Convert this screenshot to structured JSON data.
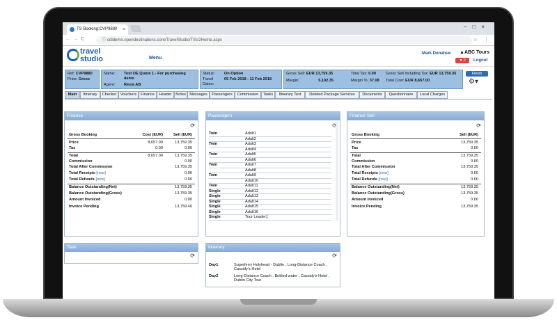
{
  "browser": {
    "tab_title": "TS Booking:CVP9880",
    "url": "odldemo.opendestinations.com/TravelStudio/TSV2Home.aspx"
  },
  "header": {
    "logo_line1": "travel",
    "logo_line2": "studio",
    "menu": "Menu",
    "user": "Mark Donahue",
    "company": "ABC Tours",
    "badge": "▼ 0",
    "logout": "Logout"
  },
  "summary": {
    "ref_label": "Ref:",
    "ref_value": "CVP9880",
    "price_label": "Price:",
    "price_value": "Gross",
    "name_label": "Name:",
    "name_value": "Test OE Quote 1 - For purchasing demo",
    "agent_label": "Agent:",
    "agent_value": "Resia AB",
    "status_label": "Status:",
    "status_value": "On Option",
    "travel_label": "Travel Dates:",
    "travel_value": "05 Feb 2018 - 11 Feb 2018",
    "gross_sell_label": "Gross Sell:",
    "gross_sell_value": "EUR 13,759.35",
    "total_tax_label": "Total Tax:",
    "total_tax_value": "0.00",
    "sell_incl_tax_label": "Gross Sell Including Tax:",
    "sell_incl_tax_value": "EUR 13,759.35",
    "margin_label": "Margin:",
    "margin_value": "5,102.35",
    "margin_pct_label": "Margin %:",
    "margin_pct_value": "37.08",
    "total_cost_label": "Total Cost:",
    "total_cost_value": "EUR 8,657.00",
    "finish": "Finish"
  },
  "tabs": [
    "Main",
    "Itinerary",
    "Checker",
    "Vouchers",
    "Finance",
    "Header",
    "Notes",
    "Messages",
    "Passengers",
    "Commission",
    "Tasks",
    "Itinerary Text",
    "Deleted Package Services",
    "Documents",
    "Questionnaire",
    "Local Charges"
  ],
  "finance": {
    "title": "Finance",
    "col_label": "Gross Booking",
    "col_cost": "Cost  (EUR)",
    "col_sell": "Sell  (EUR)",
    "price": {
      "label": "Price",
      "cost": "8,657.00",
      "sell": "13,759.35"
    },
    "tax": {
      "label": "Tax",
      "cost": "0.00",
      "sell": "0.00"
    },
    "total": {
      "label": "Total",
      "cost": "8,657.00",
      "sell": "13,759.35"
    },
    "commission": {
      "label": "Commission",
      "sell": "0.00"
    },
    "after_commission": {
      "label": "Total After Commission",
      "sell": "13,759.35"
    },
    "receipts": {
      "label": "Total Receipts",
      "link": "[new]",
      "sell": "0.00"
    },
    "refunds": {
      "label": "Total Refunds",
      "link": "[new]",
      "sell": "0.00"
    },
    "bal_net": {
      "label": "Balance Outstanding(Net)",
      "sell": "13,759.35"
    },
    "bal_gross": {
      "label": "Balance Outstanding(Gross)",
      "sell": "13,759.35"
    },
    "invoiced": {
      "label": "Amount Invoiced",
      "sell": "0.00"
    },
    "pending": {
      "label": "Invoice Pending",
      "sell": "13,759.40"
    }
  },
  "passengers": {
    "title": "Passengers",
    "rows": [
      {
        "type": "Twin",
        "name": "Adult1"
      },
      {
        "type": "",
        "name": "Adult2"
      },
      {
        "type": "Twin",
        "name": "Adult3"
      },
      {
        "type": "",
        "name": "Adult4"
      },
      {
        "type": "Twin",
        "name": "Adult5"
      },
      {
        "type": "",
        "name": "Adult6"
      },
      {
        "type": "Twin",
        "name": "Adult7"
      },
      {
        "type": "",
        "name": "Adult8"
      },
      {
        "type": "Twin",
        "name": "Adult9"
      },
      {
        "type": "",
        "name": "Adult10"
      },
      {
        "type": "Twin",
        "name": "Adult11"
      },
      {
        "type": "Single",
        "name": "Adult12"
      },
      {
        "type": "Single",
        "name": "Adult13"
      },
      {
        "type": "Single",
        "name": "Adult14"
      },
      {
        "type": "Single",
        "name": "Adult15"
      },
      {
        "type": "Single",
        "name": "Adult16"
      },
      {
        "type": "Single",
        "name": "Tour Leader1"
      }
    ]
  },
  "finance_sell": {
    "title": "Finance Sell",
    "col_label": "Gross Booking",
    "col_sell": "Sell  (EUR)",
    "price": {
      "label": "Price",
      "sell": "13,759.35"
    },
    "tax": {
      "label": "Tax",
      "sell": "0.00"
    },
    "total": {
      "label": "Total",
      "sell": "13,759.35"
    },
    "commission": {
      "label": "Commission",
      "sell": "0.00"
    },
    "after_commission": {
      "label": "Total After Commission",
      "sell": "13,759.35"
    },
    "receipts": {
      "label": "Total Receipts",
      "link": "[new]",
      "sell": "0.00"
    },
    "refunds": {
      "label": "Total Refunds",
      "link": "[new]",
      "sell": "0.00"
    },
    "bal_net": {
      "label": "Balance Outstanding(Net)",
      "sell": "13,759.35"
    },
    "bal_gross": {
      "label": "Balance Outstanding(Gross)",
      "sell": "13,759.35"
    },
    "invoiced": {
      "label": "Amount Invoiced",
      "sell": "0.00"
    },
    "pending": {
      "label": "Invoice Pending",
      "sell": "13,759.35"
    }
  },
  "task": {
    "title": "Task"
  },
  "itinerary": {
    "title": "Itinerary",
    "days": [
      {
        "day": "Day1",
        "text": "Superferry Holyhead - Dublin , Long-Distance Coach , Cassidy's Hotel"
      },
      {
        "day": "Day2",
        "text": "Long-Distance Coach , Bottled water , Cassidy's Hotel , Dublin City Tour"
      }
    ]
  }
}
